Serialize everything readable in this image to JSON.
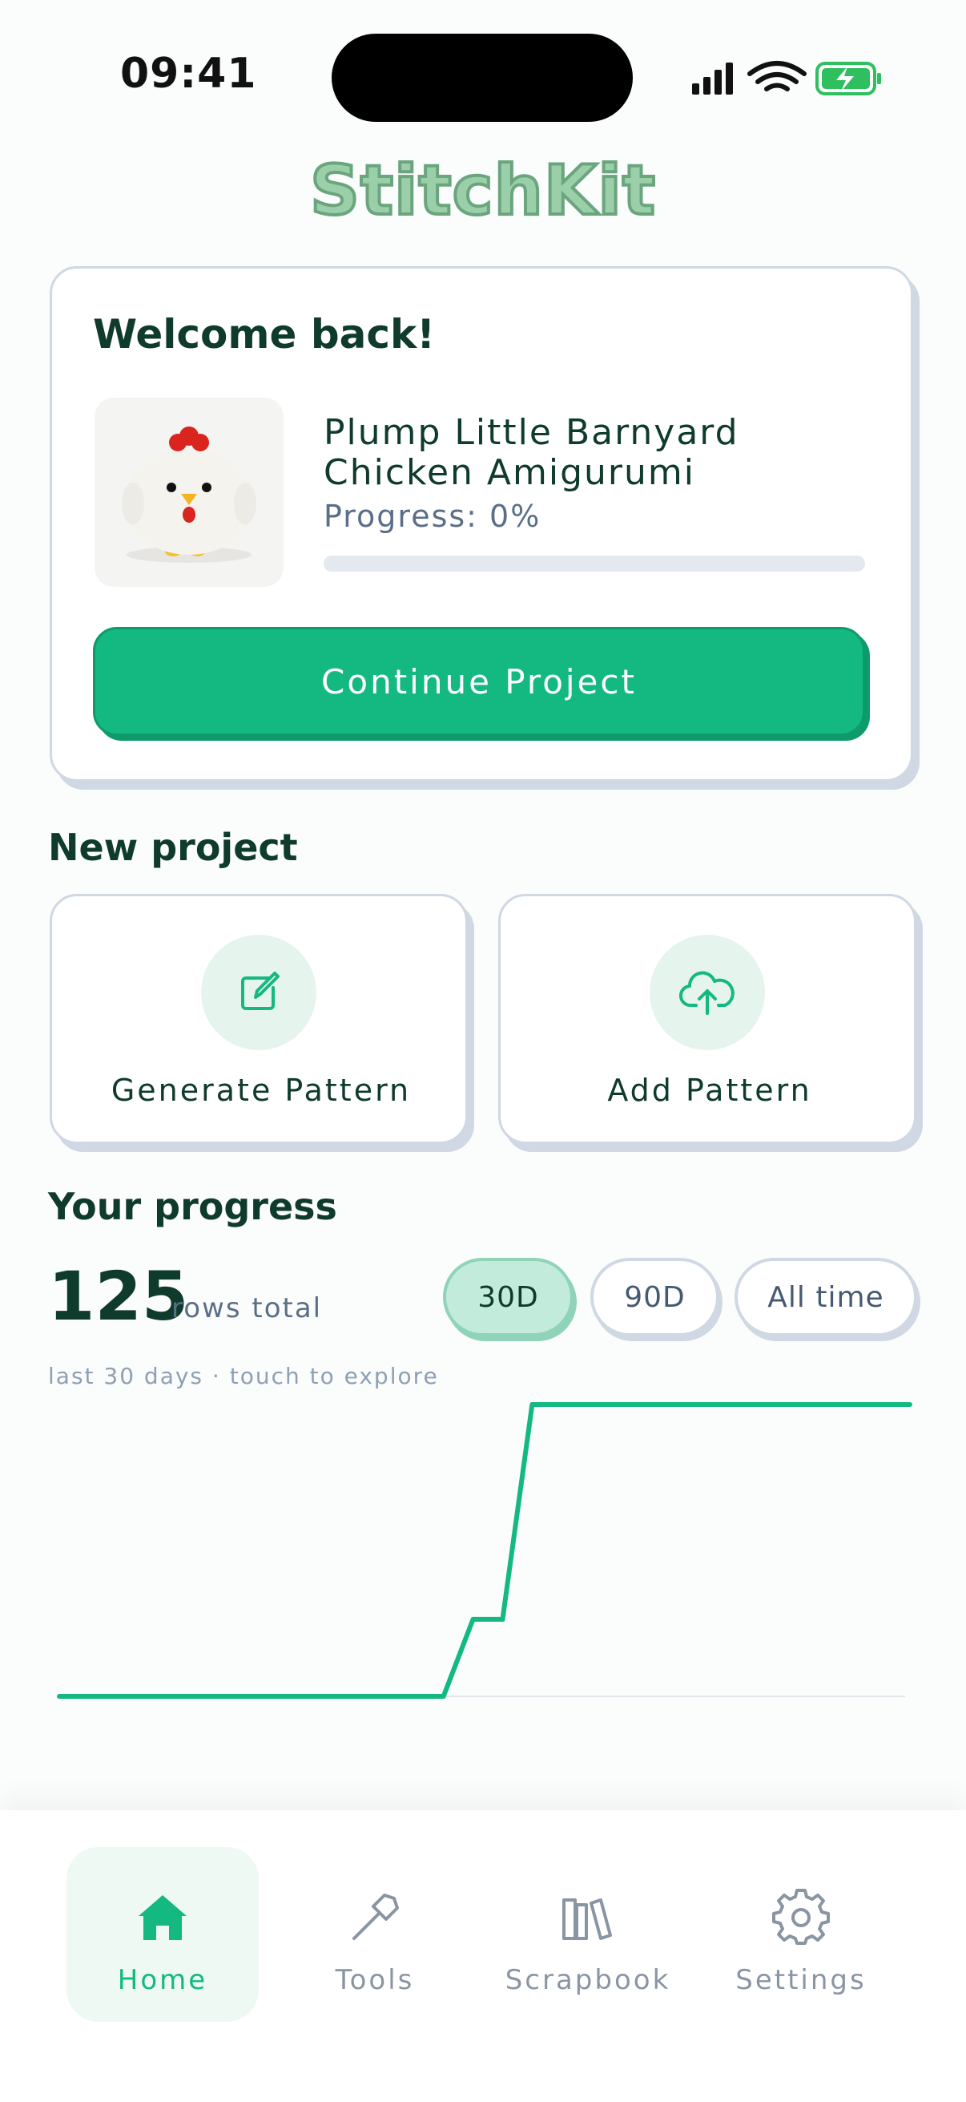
{
  "status_bar": {
    "time": "09:41"
  },
  "app": {
    "title": "StitchKit"
  },
  "welcome": {
    "title": "Welcome back!",
    "project_name": "Plump Little Barnyard Chicken Amigurumi",
    "progress_text": "Progress: 0%",
    "progress_value": 0,
    "continue_label": "Continue Project"
  },
  "new_project": {
    "heading": "New project",
    "generate_label": "Generate Pattern",
    "add_label": "Add Pattern"
  },
  "progress": {
    "heading": "Your progress",
    "total": "125",
    "total_label": "rows total",
    "ranges": [
      "30D",
      "90D",
      "All time"
    ],
    "selected_range": "30D",
    "hint": "last 30 days · touch to explore"
  },
  "chart_data": {
    "type": "line",
    "x": [
      1,
      14,
      15,
      16,
      17,
      30
    ],
    "values": [
      0,
      0,
      33,
      33,
      125,
      125
    ],
    "ylim": [
      0,
      125
    ],
    "color": "#13b981"
  },
  "nav": {
    "items": [
      {
        "label": "Home",
        "icon": "home-icon",
        "active": true
      },
      {
        "label": "Tools",
        "icon": "hammer-icon",
        "active": false
      },
      {
        "label": "Scrapbook",
        "icon": "books-icon",
        "active": false
      },
      {
        "label": "Settings",
        "icon": "gear-icon",
        "active": false
      }
    ]
  },
  "colors": {
    "accent": "#13b981",
    "text": "#0f3b2c",
    "muted": "#5a6f87"
  }
}
